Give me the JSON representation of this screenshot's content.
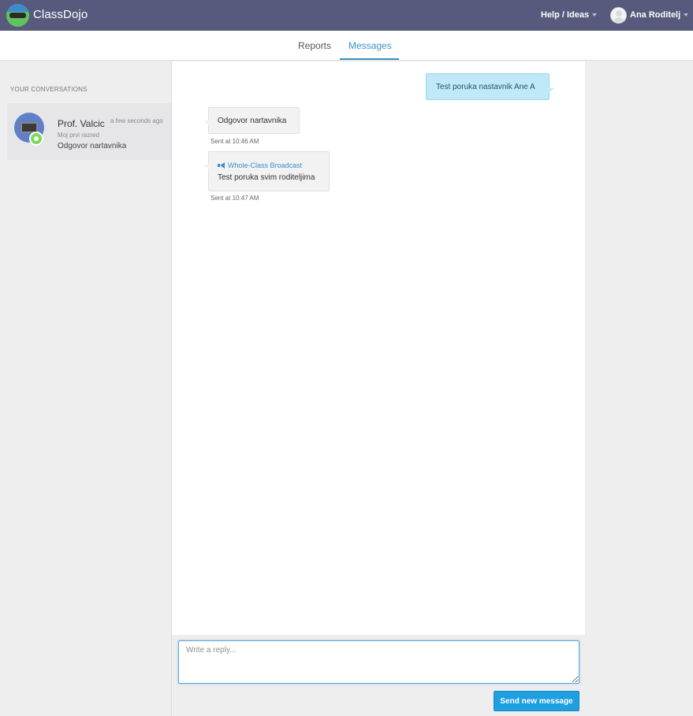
{
  "app": {
    "name": "ClassDojo",
    "help_label": "Help / Ideas",
    "user_name": "Ana Roditelj"
  },
  "tabs": [
    {
      "label": "Reports",
      "active": false
    },
    {
      "label": "Messages",
      "active": true
    }
  ],
  "sidebar": {
    "header": "YOUR CONVERSATIONS",
    "conversations": [
      {
        "name": "Prof. Valcic",
        "time": "a few seconds ago",
        "class": "Moj prvi razred",
        "preview": "Odgovor nartavnika"
      }
    ]
  },
  "messages": [
    {
      "direction": "outgoing",
      "text": "Test poruka nastavnik Ane A"
    },
    {
      "direction": "incoming",
      "text": "Odgovor nartavnika",
      "sent": "Sent at 10:46 AM"
    },
    {
      "direction": "incoming",
      "broadcast_label": "Whole-Class Broadcast",
      "text": "Test poruka svim roditeljima",
      "sent": "Sent at 10:47 AM"
    }
  ],
  "reply": {
    "placeholder": "Write a reply...",
    "send_label": "Send new message"
  },
  "colors": {
    "topbar": "#585a7d",
    "accent": "#3a92c8",
    "send_button": "#1d9fe0",
    "outgoing_bubble": "#bfe9f8"
  },
  "icons": {
    "logo": "classdojo-logo-icon",
    "broadcast": "megaphone-icon",
    "avatar": "user-avatar-icon",
    "dropdown": "caret-down-icon"
  }
}
